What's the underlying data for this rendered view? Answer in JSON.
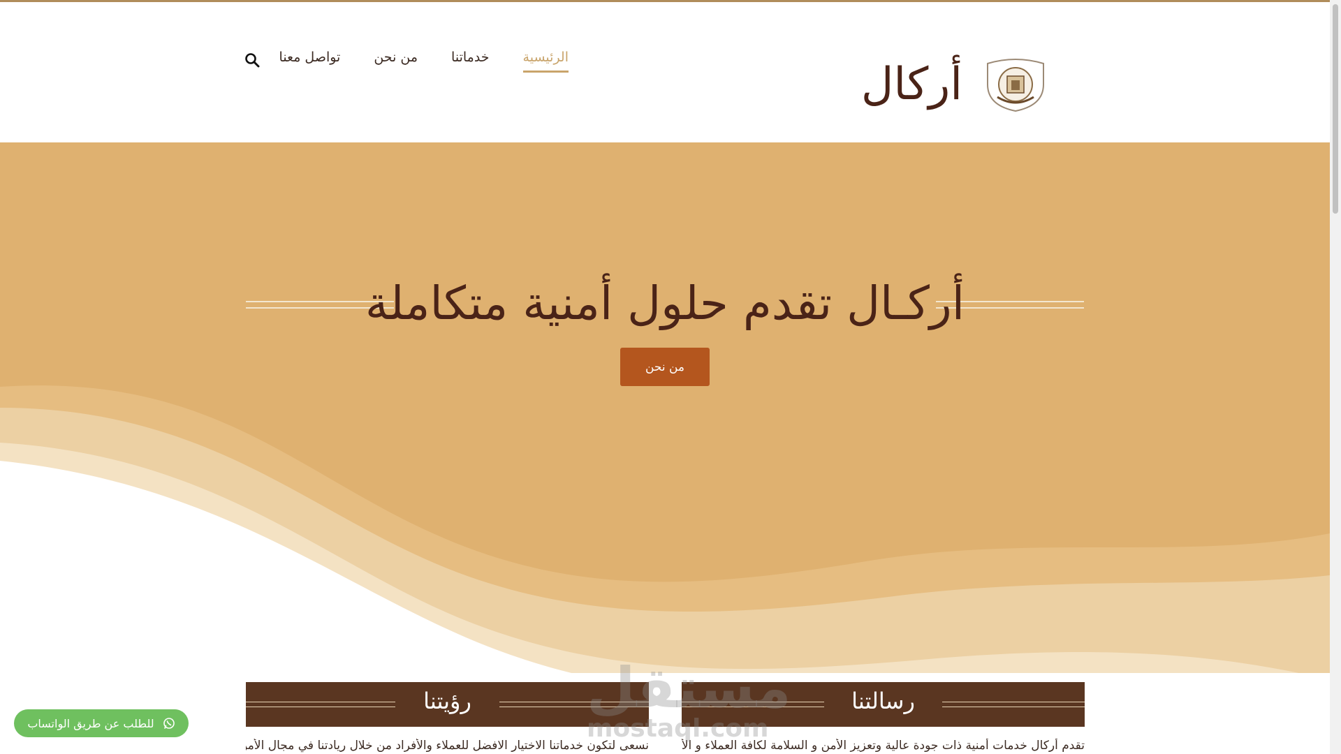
{
  "header": {
    "logo_text": "أركال",
    "nav": [
      {
        "label": "الرئيسية",
        "active": true
      },
      {
        "label": "خدماتنا",
        "active": false
      },
      {
        "label": "من نحن",
        "active": false
      },
      {
        "label": "تواصل معنا",
        "active": false
      }
    ],
    "search_icon": "search-icon"
  },
  "hero": {
    "title": "أركـال تقدم حلول أمنية متكاملة",
    "cta_label": "من نحن"
  },
  "sections": {
    "mission": {
      "title": "رسالتنا",
      "text": "تقدم أركال خدمات أمنية ذات جودة عالية وتعزيز الأمن و السلامة لكافة العملاء و الأفراد"
    },
    "vision": {
      "title": "رؤيتنا",
      "text": "نسعى لتكون خدماتنا الاختيار الافضل للعملاء والأفراد من خلال ريادتنا في مجال الأمن و"
    }
  },
  "watermark": {
    "ar": "مستقل",
    "en": "mostaql.com"
  },
  "whatsapp": {
    "label": "للطلب عن طريق الواتساب",
    "icon": "whatsapp-icon"
  },
  "colors": {
    "hero_bg": "#dfb170",
    "brand_dark": "#4a2317",
    "accent": "#c9a46b",
    "cta": "#b4561e",
    "band": "#5a3621",
    "whatsapp": "#6fc05f"
  }
}
